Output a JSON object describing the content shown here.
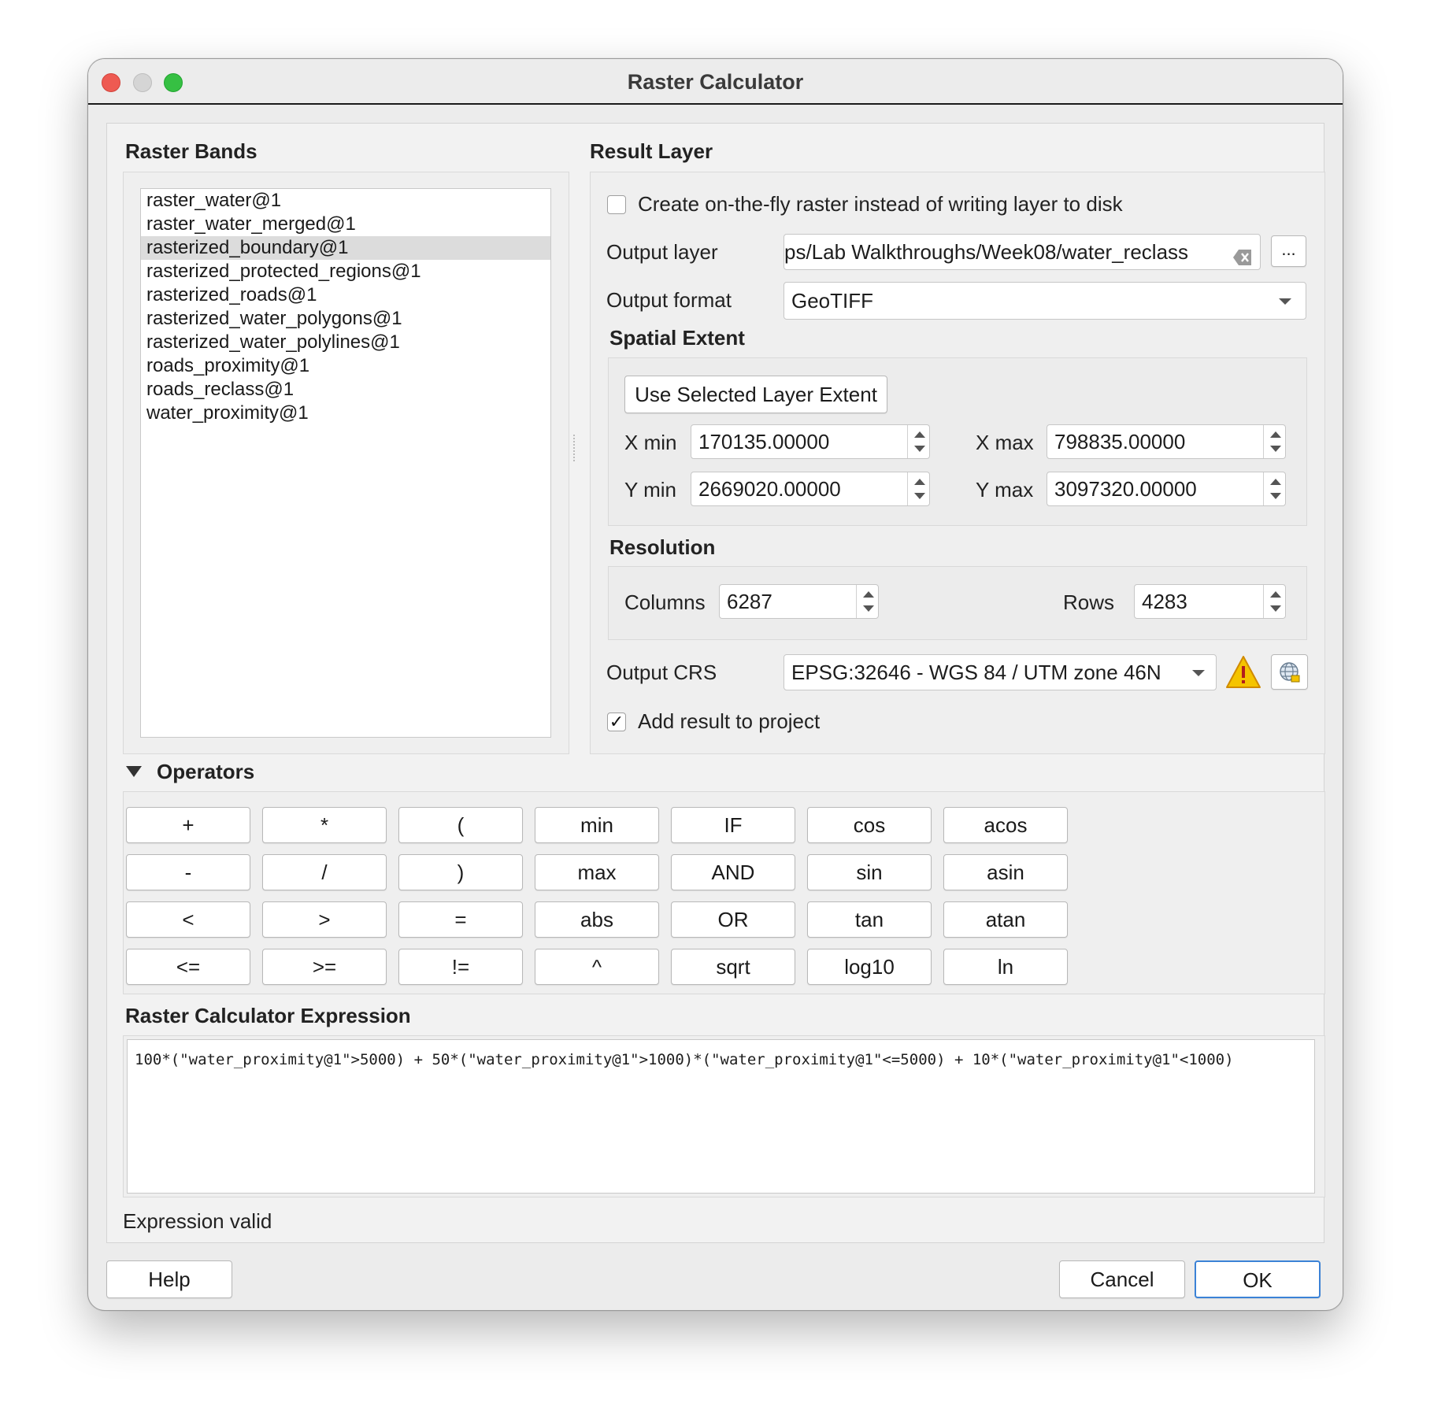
{
  "window": {
    "title": "Raster Calculator"
  },
  "raster_bands": {
    "title": "Raster Bands",
    "items": [
      "raster_water@1",
      "raster_water_merged@1",
      "rasterized_boundary@1",
      "rasterized_protected_regions@1",
      "rasterized_roads@1",
      "rasterized_water_polygons@1",
      "rasterized_water_polylines@1",
      "roads_proximity@1",
      "roads_reclass@1",
      "water_proximity@1"
    ],
    "selected_index": 2
  },
  "result_layer": {
    "title": "Result Layer",
    "on_the_fly_label": "Create on-the-fly raster instead of writing layer to disk",
    "on_the_fly_checked": false,
    "output_layer_label": "Output layer",
    "output_layer_value": "ps/Lab Walkthroughs/Week08/water_reclass",
    "browse_label": "...",
    "output_format_label": "Output format",
    "output_format_value": "GeoTIFF",
    "spatial_extent": {
      "title": "Spatial Extent",
      "use_selected_label": "Use Selected Layer Extent",
      "xmin_label": "X min",
      "xmin_value": "170135.00000",
      "xmax_label": "X max",
      "xmax_value": "798835.00000",
      "ymin_label": "Y min",
      "ymin_value": "2669020.00000",
      "ymax_label": "Y max",
      "ymax_value": "3097320.00000"
    },
    "resolution": {
      "title": "Resolution",
      "columns_label": "Columns",
      "columns_value": "6287",
      "rows_label": "Rows",
      "rows_value": "4283"
    },
    "output_crs_label": "Output CRS",
    "output_crs_value": "EPSG:32646 - WGS 84 / UTM zone 46N",
    "add_result_label": "Add result to project",
    "add_result_checked": true,
    "checkmark": "✓"
  },
  "operators": {
    "title": "Operators",
    "buttons": [
      [
        "+",
        "*",
        "(",
        "min",
        "IF",
        "cos",
        "acos"
      ],
      [
        "-",
        "/",
        ")",
        "max",
        "AND",
        "sin",
        "asin"
      ],
      [
        "<",
        ">",
        "=",
        "abs",
        "OR",
        "tan",
        "atan"
      ],
      [
        "<=",
        ">=",
        "!=",
        "^",
        "sqrt",
        "log10",
        "ln"
      ]
    ]
  },
  "expression": {
    "title": "Raster Calculator Expression",
    "value": "100*(\"water_proximity@1\">5000) + 50*(\"water_proximity@1\">1000)*(\"water_proximity@1\"<=5000) + 10*(\"water_proximity@1\"<1000)",
    "status": "Expression valid"
  },
  "footer": {
    "help_label": "Help",
    "cancel_label": "Cancel",
    "ok_label": "OK"
  },
  "colors": {
    "warning": "#f5c400",
    "ok_border": "#3b82d6"
  },
  "icons": {
    "warning": "warning-icon",
    "crs_selector": "globe-icon",
    "clear": "clear-icon",
    "collapse": "triangle-down-icon"
  }
}
